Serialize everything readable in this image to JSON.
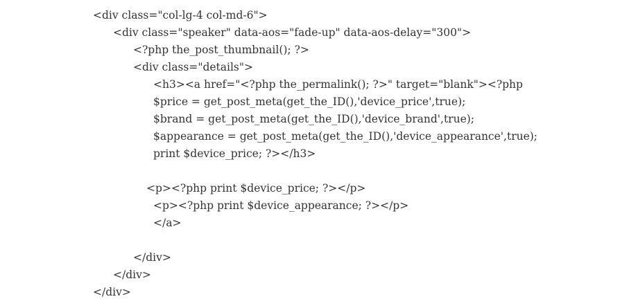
{
  "code_lines": [
    "<div class=\"col-lg-4 col-md-6\">",
    "<div class=\"speaker\" data-aos=\"fade-up\" data-aos-delay=\"300\">",
    "<?php the_post_thumbnail(); ?>",
    "<div class=\"details\">",
    "<h3><a href=\"<?php the_permalink(); ?>\" target=\"blank\"><?php",
    "$price = get_post_meta(get_the_ID(),'device_price',true);",
    "$brand = get_post_meta(get_the_ID(),'device_brand',true);",
    "$appearance = get_post_meta(get_the_ID(),'device_appearance',true);",
    "print $device_price; ?></h3>",
    "",
    "<p><?php print $device_price; ?></p>",
    "<p><?php print $device_appearance; ?></p>",
    "</a>",
    "",
    "</div>",
    "</div>",
    "</div>"
  ]
}
